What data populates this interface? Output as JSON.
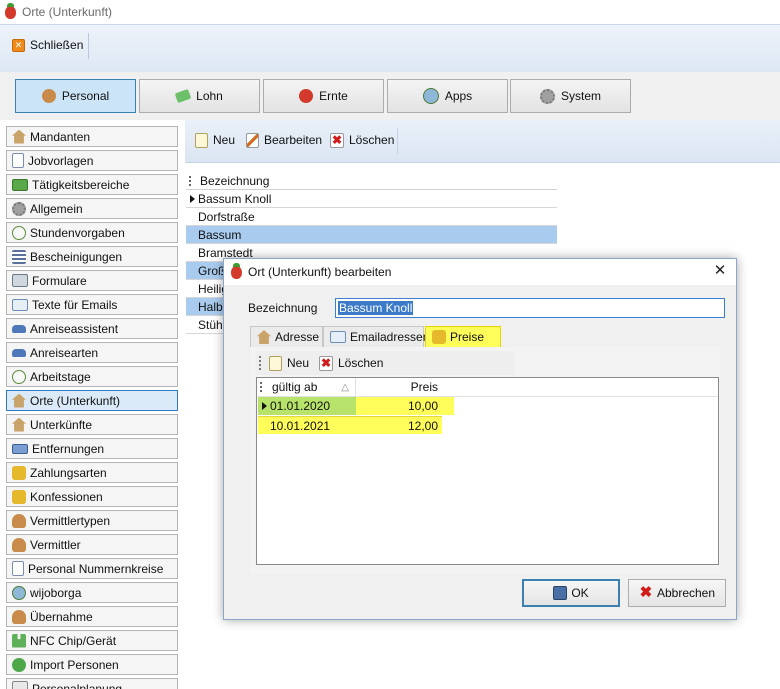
{
  "window": {
    "title": "Orte (Unterkunft)"
  },
  "toolbar": {
    "close_label": "Schließen"
  },
  "nav_tabs": [
    {
      "label": "Personal",
      "icon": "people-icon",
      "active": true
    },
    {
      "label": "Lohn",
      "icon": "money-icon",
      "active": false
    },
    {
      "label": "Ernte",
      "icon": "strawberry-icon",
      "active": false
    },
    {
      "label": "Apps",
      "icon": "globe-icon",
      "active": false
    },
    {
      "label": "System",
      "icon": "gear-icon",
      "active": false
    }
  ],
  "sidebar": {
    "items": [
      {
        "label": "Mandanten",
        "icon": "house-icon"
      },
      {
        "label": "Jobvorlagen",
        "icon": "document-icon"
      },
      {
        "label": "Tätigkeitsbereiche",
        "icon": "field-icon"
      },
      {
        "label": "Allgemein",
        "icon": "gear-icon"
      },
      {
        "label": "Stundenvorgaben",
        "icon": "clock-icon"
      },
      {
        "label": "Bescheinigungen",
        "icon": "list-icon"
      },
      {
        "label": "Formulare",
        "icon": "printer-icon"
      },
      {
        "label": "Texte für Emails",
        "icon": "email-icon"
      },
      {
        "label": "Anreiseassistent",
        "icon": "car-icon"
      },
      {
        "label": "Anreisearten",
        "icon": "car-icon"
      },
      {
        "label": "Arbeitstage",
        "icon": "clock-icon"
      },
      {
        "label": "Orte (Unterkunft)",
        "icon": "house-icon",
        "active": true
      },
      {
        "label": "Unterkünfte",
        "icon": "house-icon"
      },
      {
        "label": "Entfernungen",
        "icon": "ruler-icon"
      },
      {
        "label": "Zahlungsarten",
        "icon": "coins-icon"
      },
      {
        "label": "Konfessionen",
        "icon": "coins-icon"
      },
      {
        "label": "Vermittlertypen",
        "icon": "person-icon"
      },
      {
        "label": "Vermittler",
        "icon": "person-icon"
      },
      {
        "label": "Personal Nummernkreise",
        "icon": "document-icon"
      },
      {
        "label": "wijoborga",
        "icon": "globe-icon"
      },
      {
        "label": "Übernahme",
        "icon": "person-icon"
      },
      {
        "label": "NFC Chip/Gerät",
        "icon": "arrows-icon"
      },
      {
        "label": "Import Personen",
        "icon": "refresh-icon"
      },
      {
        "label": "Personalplanung",
        "icon": "calendar-icon"
      }
    ]
  },
  "main_toolbar": {
    "new_label": "Neu",
    "edit_label": "Bearbeiten",
    "delete_label": "Löschen"
  },
  "main_grid": {
    "header": "Bezeichnung",
    "rows": [
      "Bassum Knoll",
      "Dorfstraße",
      "Bassum",
      "Bramstedt",
      "Groß",
      "Heilig",
      "Halbe",
      "Stühr"
    ],
    "current_row": 0,
    "selected_rows": [
      2,
      4,
      6
    ]
  },
  "dialog": {
    "title": "Ort (Unterkunft) bearbeiten",
    "field_label": "Bezeichnung",
    "field_value": "Bassum Knoll",
    "tabs": [
      {
        "label": "Adresse",
        "icon": "house-icon"
      },
      {
        "label": "Emailadressen",
        "icon": "email-icon"
      },
      {
        "label": "Preise",
        "icon": "coins-icon",
        "active": true
      }
    ],
    "sub_toolbar": {
      "new_label": "Neu",
      "delete_label": "Löschen"
    },
    "price_grid": {
      "columns": [
        "gültig ab",
        "Preis"
      ],
      "rows": [
        {
          "date": "01.01.2020",
          "price": "10,00"
        },
        {
          "date": "10.01.2021",
          "price": "12,00"
        }
      ]
    },
    "ok_label": "OK",
    "cancel_label": "Abbrechen"
  },
  "colors": {
    "highlight": "#fffd5a",
    "selection": "#a9ccee",
    "accent": "#3c7fb1"
  }
}
